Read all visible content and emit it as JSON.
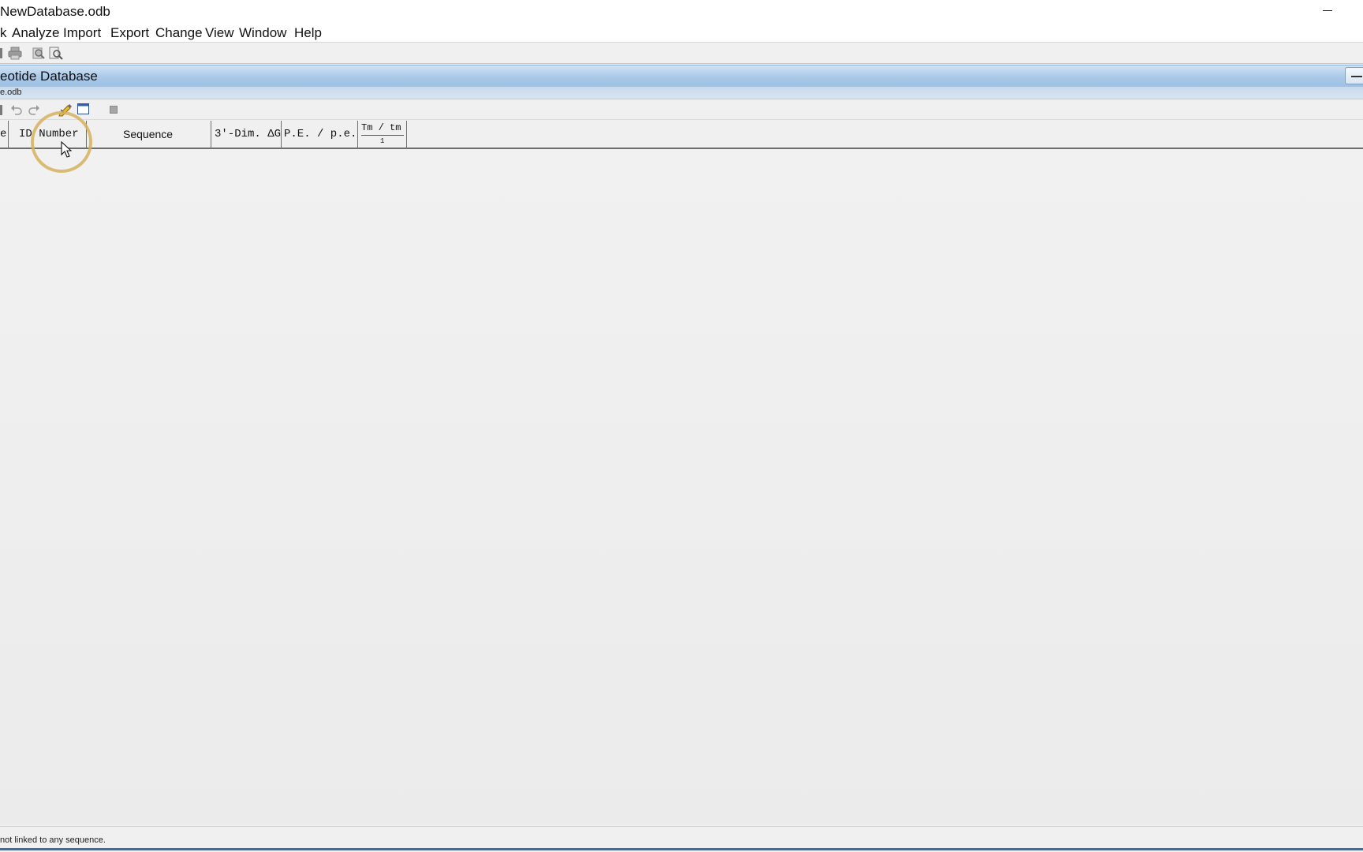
{
  "window": {
    "title": "NewDatabase.odb"
  },
  "menu": {
    "items": [
      "k",
      "Analyze",
      "Import",
      "Export",
      "Change",
      "View",
      "Window",
      "Help"
    ]
  },
  "toolbar1": {
    "icons": [
      "toolbar-edge-icon",
      "print-icon",
      "print-preview-icon",
      "zoom-preview-icon"
    ]
  },
  "document": {
    "title": "eotide Database",
    "path": "e.odb"
  },
  "toolbar2": {
    "icons": [
      "toolbar-edge-icon",
      "undo-icon",
      "redo-icon",
      "edit-pencil-icon",
      "window-icon",
      "stop-icon"
    ]
  },
  "table": {
    "columns": [
      {
        "label": "e"
      },
      {
        "label": "ID Number"
      },
      {
        "label": "Sequence"
      },
      {
        "label": "3'-Dim. ΔG"
      },
      {
        "label": "P.E. / p.e."
      },
      {
        "label": "Tm / tm",
        "sub": "1"
      }
    ],
    "rows": []
  },
  "status": {
    "text": "not linked to any sequence."
  }
}
